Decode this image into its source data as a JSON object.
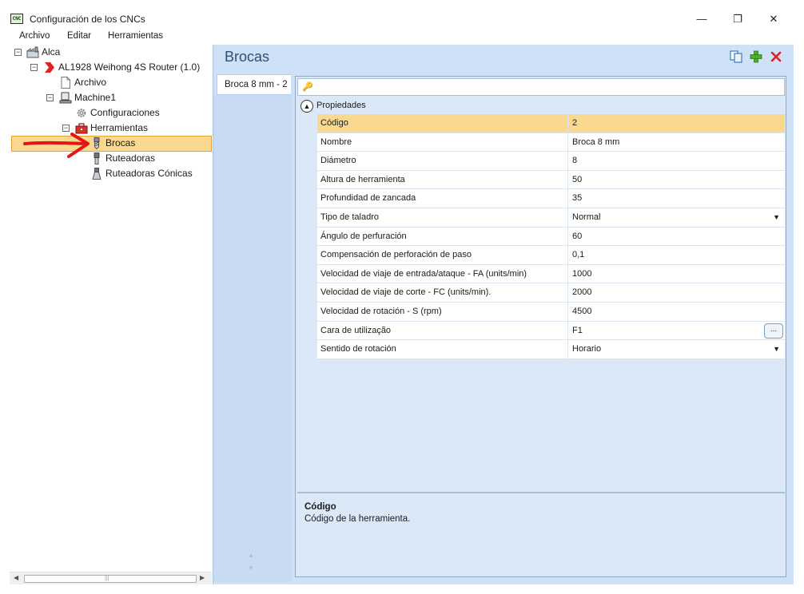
{
  "window": {
    "title": "Configuración de los CNCs",
    "app_icon_text": "CNC",
    "minimize": "—",
    "maximize": "❐",
    "close": "✕"
  },
  "menu": [
    "Archivo",
    "Editar",
    "Herramientas"
  ],
  "tree": {
    "root": "Alca",
    "machine_router": "AL1928 Weihong 4S Router (1.0)",
    "archivo": "Archivo",
    "machine": "Machine1",
    "configuraciones": "Configuraciones",
    "herramientas": "Herramientas",
    "brocas": "Brocas",
    "ruteadoras": "Ruteadoras",
    "ruteadoras_conicas": "Ruteadoras Cónicas",
    "expander_collapse": "−"
  },
  "annotation": {
    "arrow_color": "#e01818"
  },
  "header": {
    "title": "Brocas"
  },
  "tabs": [
    "Broca 8 mm - 2"
  ],
  "grid": {
    "category": "Propiedades",
    "properties": [
      {
        "name": "Código",
        "value": "2"
      },
      {
        "name": "Nombre",
        "value": "Broca 8 mm"
      },
      {
        "name": "Diámetro",
        "value": "8"
      },
      {
        "name": "Altura de herramienta",
        "value": "50"
      },
      {
        "name": "Profundidad de zancada",
        "value": "35"
      },
      {
        "name": "Tipo de taladro",
        "value": "Normal"
      },
      {
        "name": "Ángulo de perfuración",
        "value": "60"
      },
      {
        "name": "Compensación de perforación de paso",
        "value": "0,1"
      },
      {
        "name": "Velocidad de viaje de entrada/ataque - FA (units/min)",
        "value": "1000"
      },
      {
        "name": "Velocidad de viaje de corte - FC (units/min).",
        "value": "2000"
      },
      {
        "name": "Velocidad de rotación - S (rpm)",
        "value": "4500"
      },
      {
        "name": "Cara de utilização",
        "value": "F1"
      },
      {
        "name": "Sentido de rotación",
        "value": "Horario"
      }
    ],
    "ellipsis": "...",
    "dropdown_arrow": "▼"
  },
  "description": {
    "title": "Código",
    "text": "Código de la herramienta."
  },
  "colors": {
    "selection": "#fbd88f",
    "panel_blue": "#cfe1f7",
    "title_blue": "#2f4f76",
    "add_green": "#4caf2a",
    "delete_red": "#e02020"
  }
}
